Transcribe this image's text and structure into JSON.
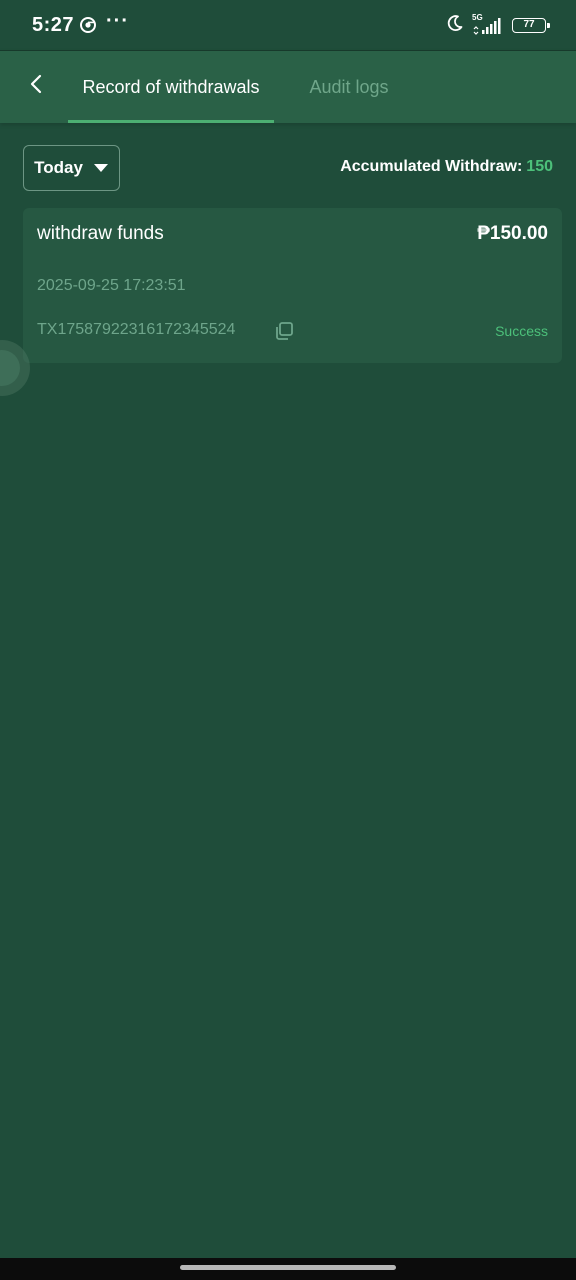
{
  "status_bar": {
    "time": "5:27",
    "dots": "···",
    "network": "5G",
    "battery": "77"
  },
  "header": {
    "back_icon": "chevron-left-icon",
    "tabs": [
      {
        "label": "Record of withdrawals",
        "active": true
      },
      {
        "label": "Audit logs",
        "active": false
      }
    ]
  },
  "filter": {
    "date_range": "Today",
    "accumulated_label": "Accumulated Withdraw:",
    "accumulated_value": "150"
  },
  "records": [
    {
      "title": "withdraw funds",
      "amount": "₱150.00",
      "datetime": "2025-09-25 17:23:51",
      "transaction_id": "TX17587922316172345524",
      "status": "Success"
    }
  ],
  "colors": {
    "background": "#1f4d3a",
    "header": "#2a6147",
    "card": "#265842",
    "accent": "#4cc07a",
    "muted_text": "#6ea58b"
  }
}
